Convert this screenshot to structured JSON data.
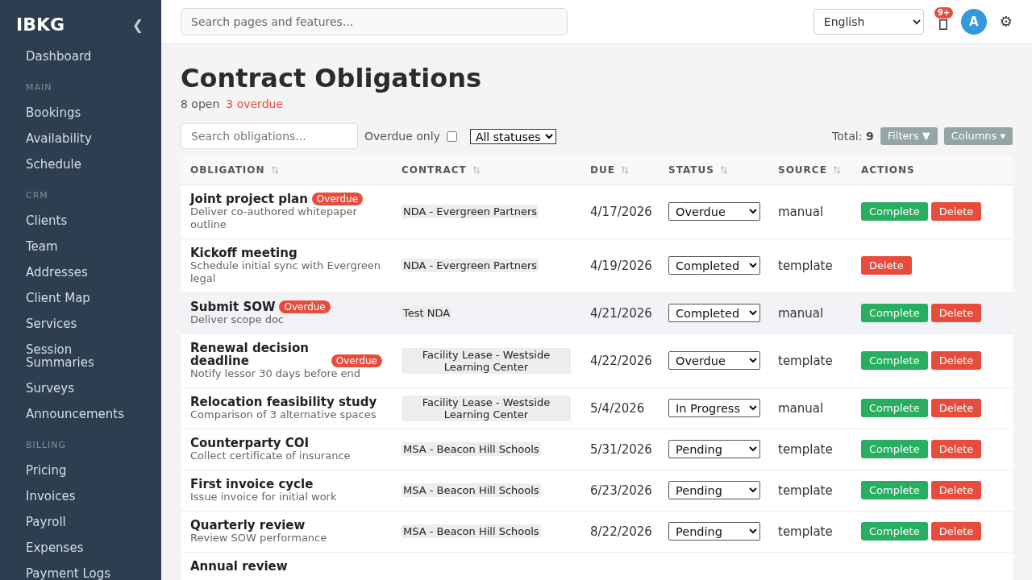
{
  "sidebar": {
    "brand": "IBKG",
    "collapse_glyph": "❮",
    "items": [
      {
        "kind": "link",
        "label": "Dashboard"
      },
      {
        "kind": "section",
        "label": "MAIN"
      },
      {
        "kind": "link",
        "label": "Bookings"
      },
      {
        "kind": "link",
        "label": "Availability"
      },
      {
        "kind": "link",
        "label": "Schedule"
      },
      {
        "kind": "section",
        "label": "CRM"
      },
      {
        "kind": "link",
        "label": "Clients"
      },
      {
        "kind": "link",
        "label": "Team"
      },
      {
        "kind": "link",
        "label": "Addresses"
      },
      {
        "kind": "link",
        "label": "Client Map"
      },
      {
        "kind": "link",
        "label": "Services"
      },
      {
        "kind": "link",
        "label": "Session Summaries"
      },
      {
        "kind": "link",
        "label": "Surveys"
      },
      {
        "kind": "link",
        "label": "Announcements"
      },
      {
        "kind": "section",
        "label": "BILLING"
      },
      {
        "kind": "link",
        "label": "Pricing"
      },
      {
        "kind": "link",
        "label": "Invoices"
      },
      {
        "kind": "link",
        "label": "Payroll"
      },
      {
        "kind": "link",
        "label": "Expenses"
      },
      {
        "kind": "link",
        "label": "Payment Logs"
      }
    ]
  },
  "topbar": {
    "search": {
      "placeholder": "Search pages and features..."
    },
    "language": "English",
    "notification_badge": "9+",
    "avatar": "A",
    "settings_glyph": "⚙"
  },
  "page": {
    "title": "Contract Obligations",
    "open_count": "8 open",
    "overdue_count": "3 overdue"
  },
  "toolbar": {
    "search": {
      "placeholder": "Search obligations..."
    },
    "overdue_only": {
      "label": "Overdue only",
      "checked": false
    },
    "status_filter": "All statuses",
    "total": "Total: **9**",
    "buttons": [
      {
        "label": "Filters ▼"
      },
      {
        "label": "Columns ▾"
      }
    ]
  },
  "table": {
    "columns": [
      {
        "label": "OBLIGATION",
        "sortable": true
      },
      {
        "label": "CONTRACT",
        "sortable": true
      },
      {
        "label": "DUE",
        "sortable": true
      },
      {
        "label": "STATUS",
        "sortable": true
      },
      {
        "label": "SOURCE",
        "sortable": true
      },
      {
        "label": "ACTIONS",
        "sortable": false
      }
    ],
    "rows": [
      {
        "title": "Joint project plan",
        "badge": "Overdue",
        "description": "Deliver co-authored whitepaper outline",
        "contract": "NDA - Evergreen Partners",
        "due": "4/17/2026",
        "status": "Overdue",
        "source": "manual",
        "actions": [
          {
            "kind": "complete",
            "label": "Complete"
          },
          {
            "kind": "delete",
            "label": "Delete"
          }
        ],
        "highlighted": false
      },
      {
        "title": "Kickoff meeting",
        "description": "Schedule initial sync with Evergreen legal",
        "contract": "NDA - Evergreen Partners",
        "due": "4/19/2026",
        "status": "Completed",
        "source": "template",
        "actions": [
          {
            "kind": "delete",
            "label": "Delete"
          }
        ],
        "highlighted": false
      },
      {
        "title": "Submit SOW",
        "badge": "Overdue",
        "description": "Deliver scope doc",
        "contract": "Test NDA",
        "due": "4/21/2026",
        "status": "Completed",
        "source": "manual",
        "actions": [
          {
            "kind": "complete",
            "label": "Complete"
          },
          {
            "kind": "delete",
            "label": "Delete"
          }
        ],
        "highlighted": true
      },
      {
        "title": "Renewal decision deadline",
        "badge": "Overdue",
        "description": "Notify lessor 30 days before end",
        "contract": "Facility Lease - Westside Learning Center",
        "due": "4/22/2026",
        "status": "Overdue",
        "source": "template",
        "actions": [
          {
            "kind": "complete",
            "label": "Complete"
          },
          {
            "kind": "delete",
            "label": "Delete"
          }
        ],
        "highlighted": false
      },
      {
        "title": "Relocation feasibility study",
        "description": "Comparison of 3 alternative spaces",
        "contract": "Facility Lease - Westside Learning Center",
        "due": "5/4/2026",
        "status": "In Progress",
        "source": "manual",
        "actions": [
          {
            "kind": "complete",
            "label": "Complete"
          },
          {
            "kind": "delete",
            "label": "Delete"
          }
        ],
        "highlighted": false
      },
      {
        "title": "Counterparty COI",
        "description": "Collect certificate of insurance",
        "contract": "MSA - Beacon Hill Schools",
        "due": "5/31/2026",
        "status": "Pending",
        "source": "template",
        "actions": [
          {
            "kind": "complete",
            "label": "Complete"
          },
          {
            "kind": "delete",
            "label": "Delete"
          }
        ],
        "highlighted": false
      },
      {
        "title": "First invoice cycle",
        "description": "Issue invoice for initial work",
        "contract": "MSA - Beacon Hill Schools",
        "due": "6/23/2026",
        "status": "Pending",
        "source": "template",
        "actions": [
          {
            "kind": "complete",
            "label": "Complete"
          },
          {
            "kind": "delete",
            "label": "Delete"
          }
        ],
        "highlighted": false
      },
      {
        "title": "Quarterly review",
        "description": "Review SOW performance",
        "contract": "MSA - Beacon Hill Schools",
        "due": "8/22/2026",
        "status": "Pending",
        "source": "template",
        "actions": [
          {
            "kind": "complete",
            "label": "Complete"
          },
          {
            "kind": "delete",
            "label": "Delete"
          }
        ],
        "highlighted": false
      },
      {
        "title": "Annual review",
        "highlighted": false
      }
    ]
  }
}
